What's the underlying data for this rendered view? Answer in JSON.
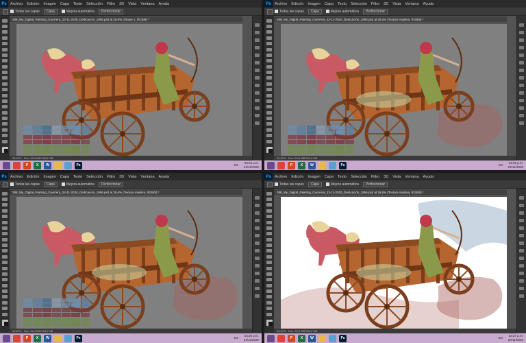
{
  "app": {
    "logo": "Ps",
    "menu": [
      "Archivo",
      "Edición",
      "Imagen",
      "Capa",
      "Texto",
      "Selección",
      "Filtro",
      "3D",
      "Vista",
      "Ventana",
      "Ayuda"
    ],
    "options": {
      "sample_all_layers": "Todas las capas",
      "layer_label": "Capa",
      "refine_edge": "Perfeccionar",
      "auto_enhance": "Mejora automática"
    }
  },
  "panes": [
    {
      "doc_title": "288_My_Digital_Painting_Guerrera_23-11-2020_Dedicación_1956.psd al 25,6% (Shape 1, RGB/8) *",
      "zoom": "25,63%",
      "doc_info": "Doc: 28,3 MB/784,0 MB",
      "time": "03:24 p.m.",
      "date": "24/11/2020",
      "lang": "ES",
      "white_canvas": false,
      "smoke": false
    },
    {
      "doc_title": "288_My_Digital_Painting_Guerrera_23-11-2020_Dedicación_1956.psd al 25,6% (Textura madera, RGB/8) *",
      "zoom": "25,63%",
      "doc_info": "Doc: 28,3 MB/784,0 MB",
      "time": "03:29 p.m.",
      "date": "24/11/2020",
      "lang": "ES",
      "white_canvas": false,
      "smoke": true
    },
    {
      "doc_title": "288_My_Digital_Painting_Guerrera_23-11-2020_Dedicación_1956.psd al 25,6% (Textura madera, RGB/8) *",
      "zoom": "25,63%",
      "doc_info": "Doc: 28,3 MB/784,0 MB",
      "time": "03:30 p.m.",
      "date": "24/11/2020",
      "lang": "ES",
      "white_canvas": false,
      "smoke": true
    },
    {
      "doc_title": "288_My_Digital_Painting_Guerrera_23-11-2020_Dedicación_1956.psd al 25,6% (Textura madera, RGB/8) *",
      "zoom": "25,63%",
      "doc_info": "Doc: 28,3 MB/784,0 MB",
      "time": "03:37 p.m.",
      "date": "24/11/2020",
      "lang": "ES",
      "white_canvas": true,
      "smoke": true
    }
  ],
  "taskbar": {
    "icons": [
      {
        "name": "windows-start-icon",
        "color": "#6a4a8a",
        "label": ""
      },
      {
        "name": "chrome-icon",
        "color": "#db4437",
        "label": ""
      },
      {
        "name": "powerpoint-icon",
        "color": "#d24726",
        "label": "P"
      },
      {
        "name": "excel-icon",
        "color": "#1d7044",
        "label": "X"
      },
      {
        "name": "word-icon",
        "color": "#2b579a",
        "label": "W"
      },
      {
        "name": "file-explorer-icon",
        "color": "#e8b84a",
        "label": ""
      },
      {
        "name": "notes-icon",
        "color": "#5aa0d0",
        "label": ""
      },
      {
        "name": "photoshop-icon",
        "color": "#001d34",
        "label": "Ps"
      }
    ]
  },
  "colors": {
    "canvas_gray": "#808080",
    "wood": "#b5652f",
    "horse": "#c95a63",
    "mane": "#e8d49a",
    "archer_dress": "#8a9a4a",
    "archer_hair": "#c0384a"
  }
}
